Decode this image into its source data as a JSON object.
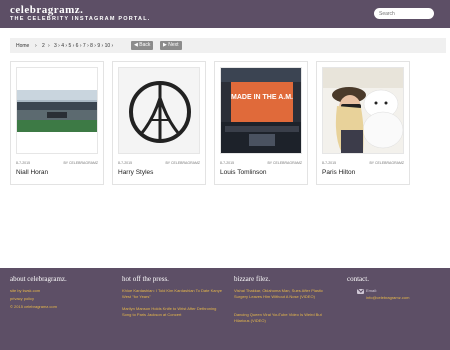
{
  "header": {
    "logo": "celebragramz.",
    "tagline": "THE CELEBRITY INSTAGRAM PORTAL.",
    "search_placeholder": "Search"
  },
  "breadcrumb": {
    "home": "Home",
    "sep": "›",
    "current_page": "2",
    "pages": "3 › 4 › 5 › 6 › 7 › 8 › 9 › 10 ›",
    "back_label": "◀ Back",
    "next_label": "▶ Next"
  },
  "cards": [
    {
      "name": "Niall Horan",
      "date": "8-7-2015",
      "by": "BY CELEBRAGRAMZ",
      "image": "stadium-photo"
    },
    {
      "name": "Harry Styles",
      "date": "8-7-2015",
      "by": "BY CELEBRAGRAMZ",
      "image": "eiffel-peace-sign"
    },
    {
      "name": "Louis Tomlinson",
      "date": "8-7-2015",
      "by": "BY CELEBRAGRAMZ",
      "image": "made-in-the-am-screen"
    },
    {
      "name": "Paris Hilton",
      "date": "8-7-2015",
      "by": "BY CELEBRAGRAMZ",
      "image": "paris-with-hello-kitty"
    }
  ],
  "footer": {
    "about": {
      "heading": "about celebragramz.",
      "links": [
        "site by kwsk.com",
        "privacy policy",
        "© 2015 celebragramz.com"
      ]
    },
    "hot": {
      "heading": "hot off the press.",
      "links": [
        "Khloe Kardashian: I Told Kim Kardashian To Date Kanye West \"for Years\"",
        "Marilyn Manson Holds Knife to Wrist After Dethroning Song to Paris Jackson at Concert"
      ]
    },
    "bizzare": {
      "heading": "bizzare filez.",
      "links": [
        "Vishal Thakkar, Oklahoma Man, Sues After Plastic Surgery Leaves Him Without A Nose (VIDEO)",
        "Dancing Queen Viral YouTube Video Is Weird But Hilarious (VIDEO)"
      ]
    },
    "contact": {
      "heading": "contact.",
      "email_label": "Email:",
      "email": "info@celebragramz.com"
    }
  },
  "colors": {
    "brand": "#5d4f66",
    "link": "#e8b94a",
    "button": "#8c8c8c"
  }
}
